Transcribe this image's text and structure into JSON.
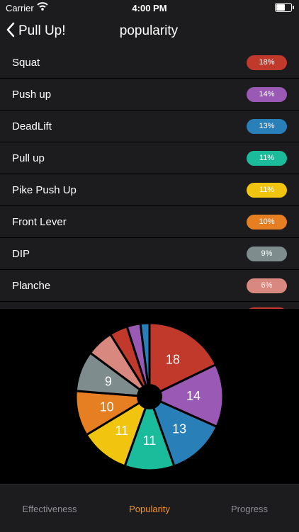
{
  "status_bar": {
    "carrier": "Carrier",
    "time": "4:00 PM"
  },
  "nav": {
    "back_label": "Pull Up!",
    "title": "popularity"
  },
  "list": {
    "items": [
      {
        "name": "Squat",
        "percent": "18%",
        "color": "#c0392b"
      },
      {
        "name": "Push up",
        "percent": "14%",
        "color": "#9b59b6"
      },
      {
        "name": "DeadLift",
        "percent": "13%",
        "color": "#2980b9"
      },
      {
        "name": "Pull up",
        "percent": "11%",
        "color": "#1abc9c"
      },
      {
        "name": "Pike Push Up",
        "percent": "11%",
        "color": "#f1c40f"
      },
      {
        "name": "Front Lever",
        "percent": "10%",
        "color": "#e67e22"
      },
      {
        "name": "DIP",
        "percent": "9%",
        "color": "#7f8c8d"
      },
      {
        "name": "Planche",
        "percent": "6%",
        "color": "#d98880"
      }
    ],
    "peek_color": "#c0392b"
  },
  "chart_data": {
    "type": "pie",
    "values": [
      18,
      14,
      13,
      11,
      11,
      10,
      9,
      6,
      4,
      3,
      2
    ],
    "labels": [
      "18",
      "14",
      "13",
      "11",
      "11",
      "10",
      "9",
      "",
      "",
      "",
      ""
    ],
    "colors": [
      "#c0392b",
      "#9b59b6",
      "#2980b9",
      "#1abc9c",
      "#f1c40f",
      "#e67e22",
      "#7f8c8d",
      "#d98880",
      "#c0392b",
      "#9b59b6",
      "#2980b9"
    ],
    "hole": true
  },
  "tabs": {
    "effectiveness": "Effectiveness",
    "popularity": "Popularity",
    "progress": "Progress",
    "active": "popularity",
    "active_color": "#f0932b"
  }
}
